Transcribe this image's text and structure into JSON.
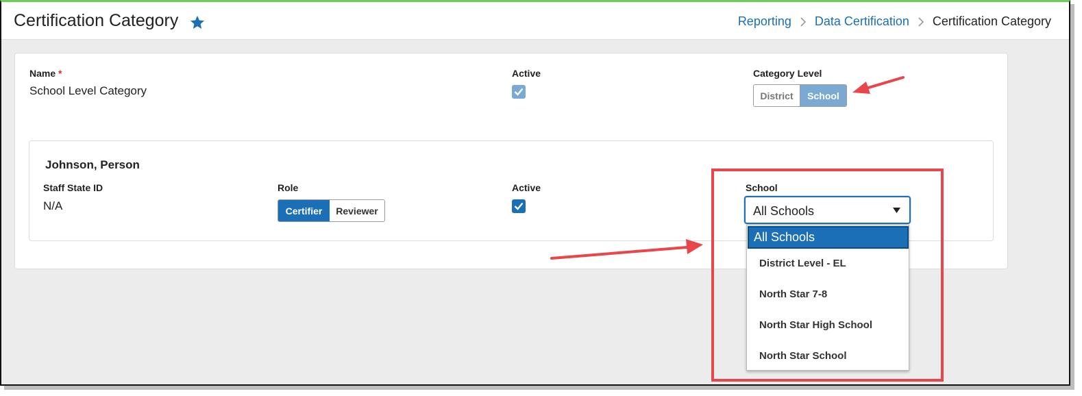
{
  "header": {
    "title": "Certification Category",
    "breadcrumb": [
      "Reporting",
      "Data Certification",
      "Certification Category"
    ]
  },
  "category": {
    "name_label": "Name",
    "name_required": "*",
    "name_value": "School Level Category",
    "active_label": "Active",
    "active_checked": true,
    "level_label": "Category Level",
    "level_options": [
      "District",
      "School"
    ],
    "level_selected": "School"
  },
  "person": {
    "name": "Johnson, Person",
    "staff_id_label": "Staff State ID",
    "staff_id_value": "N/A",
    "role_label": "Role",
    "role_options": [
      "Certifier",
      "Reviewer"
    ],
    "role_selected": "Certifier",
    "active_label": "Active",
    "active_checked": true,
    "school_label": "School",
    "school_selected": "All Schools",
    "school_options": [
      "All Schools",
      "District Level - EL",
      "North Star 7-8",
      "North Star High School",
      "North Star School"
    ]
  },
  "colors": {
    "accent": "#1a6fb7",
    "annotation": "#e8464b",
    "active_light": "#7aa9d4"
  }
}
